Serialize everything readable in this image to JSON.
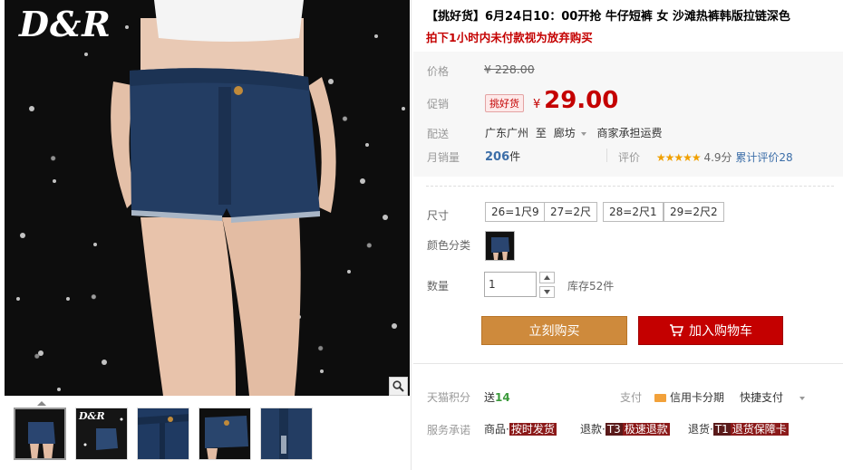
{
  "gallery": {
    "logo": "D&R",
    "thumbnails": [
      "thumb-1",
      "thumb-2",
      "thumb-3",
      "thumb-4",
      "thumb-5"
    ],
    "thumb2_logo": "D&R"
  },
  "product": {
    "title": "【挑好货】6月24日10：00开抢 牛仔短裤 女 沙滩热裤韩版拉链深色",
    "subtitle": "拍下1小时内未付款视为放弃购买"
  },
  "price": {
    "label": "价格",
    "original": "¥ 228.00",
    "promo_label": "促销",
    "promo_tag": "挑好货",
    "promo_currency": "¥",
    "promo_value": "29.00"
  },
  "shipping": {
    "label": "配送",
    "from": "广东广州",
    "to_word": "至",
    "dest": "廊坊",
    "fee": "商家承担运费"
  },
  "sales": {
    "label": "月销量",
    "count": "206",
    "unit": "件",
    "review_label": "评价",
    "stars": "★★★★★",
    "score": "4.9分",
    "total_reviews": "累计评价28"
  },
  "size": {
    "label": "尺寸",
    "options": [
      "26=1尺9",
      "27=2尺",
      "28=2尺1",
      "29=2尺2"
    ]
  },
  "color": {
    "label": "颜色分类"
  },
  "quantity": {
    "label": "数量",
    "value": "1",
    "stock": "库存52件"
  },
  "actions": {
    "buy_now": "立刻购买",
    "add_to_cart": "加入购物车"
  },
  "footer": {
    "points_label": "天猫积分",
    "points_prefix": "送",
    "points_value": "14",
    "pay_label": "支付",
    "credit": "信用卡分期",
    "fastpay": "快捷支付",
    "service_label": "服务承诺",
    "svc1_text": "商品·",
    "svc1_tag": "按时发货",
    "svc2_text": "退款·",
    "svc2_tag_code": "T3",
    "svc2_tag": "极速退款",
    "svc3_text": "退货·",
    "svc3_tag_code": "T1",
    "svc3_tag": "退货保障卡"
  },
  "colors": {
    "accent_red": "#c40000",
    "buy_orange": "#ce8a3c",
    "link_blue": "#3c6ea8"
  }
}
